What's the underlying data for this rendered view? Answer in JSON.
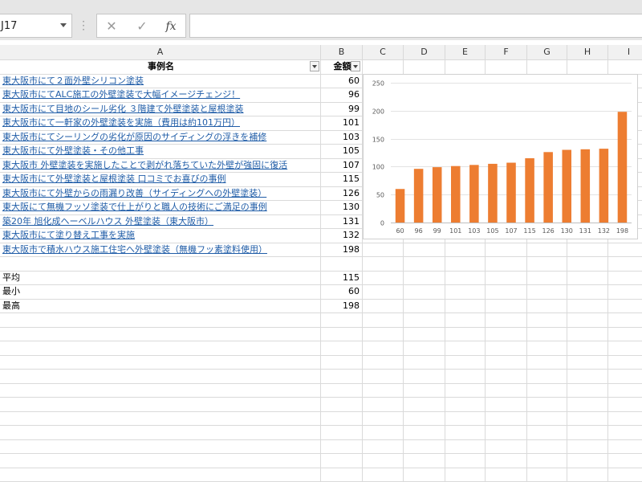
{
  "namebox": {
    "value": "J17"
  },
  "formula_bar": {
    "fx_label": "fx",
    "cancel_glyph": "✕",
    "enter_glyph": "✓",
    "value": ""
  },
  "columns": [
    "A",
    "B",
    "C",
    "D",
    "E",
    "F",
    "G",
    "H",
    "I"
  ],
  "table": {
    "header_name": "事例名",
    "header_amount": "金額",
    "rows": [
      {
        "name": "東大阪市にて２面外壁シリコン塗装",
        "amount": "60"
      },
      {
        "name": "東大阪市にてALC施工の外壁塗装で大幅イメージチェンジ！",
        "amount": "96"
      },
      {
        "name": "東大阪市にて目地のシール劣化 ３階建て外壁塗装と屋根塗装",
        "amount": "99"
      },
      {
        "name": "東大阪市にて一軒家の外壁塗装を実施（費用は約101万円）",
        "amount": "101"
      },
      {
        "name": "東大阪市にてシーリングの劣化が原因のサイディングの浮きを補修",
        "amount": "103"
      },
      {
        "name": "東大阪市にて外壁塗装・その他工事",
        "amount": "105"
      },
      {
        "name": "東大阪市 外壁塗装を実施したことで剥がれ落ちていた外壁が強固に復活",
        "amount": "107"
      },
      {
        "name": "東大阪市にて外壁塗装と屋根塗装 口コミでお喜びの事例",
        "amount": "115"
      },
      {
        "name": "東大阪市にて外壁からの雨漏り改善（サイディングへの外壁塗装）",
        "amount": "126"
      },
      {
        "name": "東大阪にて無機フッソ塗装で仕上がりと職人の技術にご満足の事例",
        "amount": "130"
      },
      {
        "name": "築20年 旭化成ヘーベルハウス 外壁塗装（東大阪市）",
        "amount": "131"
      },
      {
        "name": "東大阪市にて塗り替え工事を実施",
        "amount": "132"
      },
      {
        "name": "東大阪市で積水ハウス施工住宅へ外壁塗装（無機フッ素塗料使用）",
        "amount": "198"
      }
    ],
    "stats": [
      {
        "label": "平均",
        "value": "115"
      },
      {
        "label": "最小",
        "value": "60"
      },
      {
        "label": "最高",
        "value": "198"
      }
    ]
  },
  "chart_data": {
    "type": "bar",
    "categories": [
      "60",
      "96",
      "99",
      "101",
      "103",
      "105",
      "107",
      "115",
      "126",
      "130",
      "131",
      "132",
      "198"
    ],
    "values": [
      60,
      96,
      99,
      101,
      103,
      105,
      107,
      115,
      126,
      130,
      131,
      132,
      198
    ],
    "ylim": [
      0,
      250
    ],
    "yticks": [
      0,
      50,
      100,
      150,
      200,
      250
    ],
    "grid": true,
    "bar_color": "#ed7d31",
    "title": "",
    "xlabel": "",
    "ylabel": ""
  }
}
